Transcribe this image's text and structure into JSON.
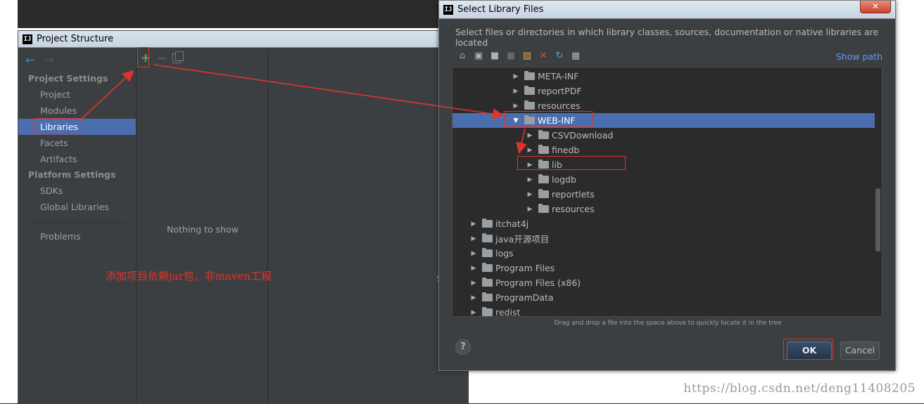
{
  "project_structure": {
    "title": "Project Structure",
    "logo": "IJ",
    "sections": [
      {
        "heading": "Project Settings",
        "items": [
          "Project",
          "Modules",
          "Libraries",
          "Facets",
          "Artifacts"
        ]
      },
      {
        "heading": "Platform Settings",
        "items": [
          "SDKs",
          "Global Libraries"
        ]
      }
    ],
    "problems": "Problems",
    "selected_item": "Libraries",
    "empty_text": "Nothing to show",
    "right_char": "S",
    "icons": {
      "back": "back-arrow-icon",
      "forward": "forward-arrow-icon",
      "add": "plus-icon",
      "remove": "minus-icon",
      "copy": "copy-icon"
    }
  },
  "annotation": "添加项目依赖jar包，非maven工程",
  "dialog": {
    "title": "Select Library Files",
    "logo": "IJ",
    "close": "✕",
    "description": "Select files or directories in which library classes, sources, documentation or native libraries are located",
    "show_path": "Show path",
    "toolbar_icons": [
      "home-icon",
      "desktop-icon",
      "project-folder-icon",
      "module-folder-icon",
      "new-folder-icon",
      "delete-icon",
      "refresh-icon",
      "show-hidden-icon"
    ],
    "tree": [
      {
        "label": "META-INF",
        "level": 2,
        "expanded": false,
        "selected": false
      },
      {
        "label": "reportPDF",
        "level": 2,
        "expanded": false,
        "selected": false
      },
      {
        "label": "resources",
        "level": 2,
        "expanded": false,
        "selected": false
      },
      {
        "label": "WEB-INF",
        "level": 2,
        "expanded": true,
        "selected": true
      },
      {
        "label": "CSVDownload",
        "level": 3,
        "expanded": false,
        "selected": false
      },
      {
        "label": "finedb",
        "level": 3,
        "expanded": false,
        "selected": false
      },
      {
        "label": "lib",
        "level": 3,
        "expanded": false,
        "selected": false
      },
      {
        "label": "logdb",
        "level": 3,
        "expanded": false,
        "selected": false
      },
      {
        "label": "reportlets",
        "level": 3,
        "expanded": false,
        "selected": false
      },
      {
        "label": "resources",
        "level": 3,
        "expanded": false,
        "selected": false
      },
      {
        "label": "itchat4j",
        "level": 0,
        "expanded": false,
        "selected": false
      },
      {
        "label": "java开源项目",
        "level": 0,
        "expanded": false,
        "selected": false
      },
      {
        "label": "logs",
        "level": 0,
        "expanded": false,
        "selected": false
      },
      {
        "label": "Program Files",
        "level": 0,
        "expanded": false,
        "selected": false
      },
      {
        "label": "Program Files (x86)",
        "level": 0,
        "expanded": false,
        "selected": false
      },
      {
        "label": "ProgramData",
        "level": 0,
        "expanded": false,
        "selected": false
      },
      {
        "label": "redist",
        "level": 0,
        "expanded": false,
        "selected": false
      }
    ],
    "drag_hint": "Drag and drop a file into the space above to quickly locate it in the tree",
    "help": "?",
    "ok": "OK",
    "cancel": "Cancel"
  },
  "watermark": "https://blog.csdn.net/deng11408205",
  "colors": {
    "selection": "#4b6eaf",
    "annotation_red": "#e0342a",
    "panel": "#3c3f41",
    "tree_bg": "#2b2b2b"
  }
}
